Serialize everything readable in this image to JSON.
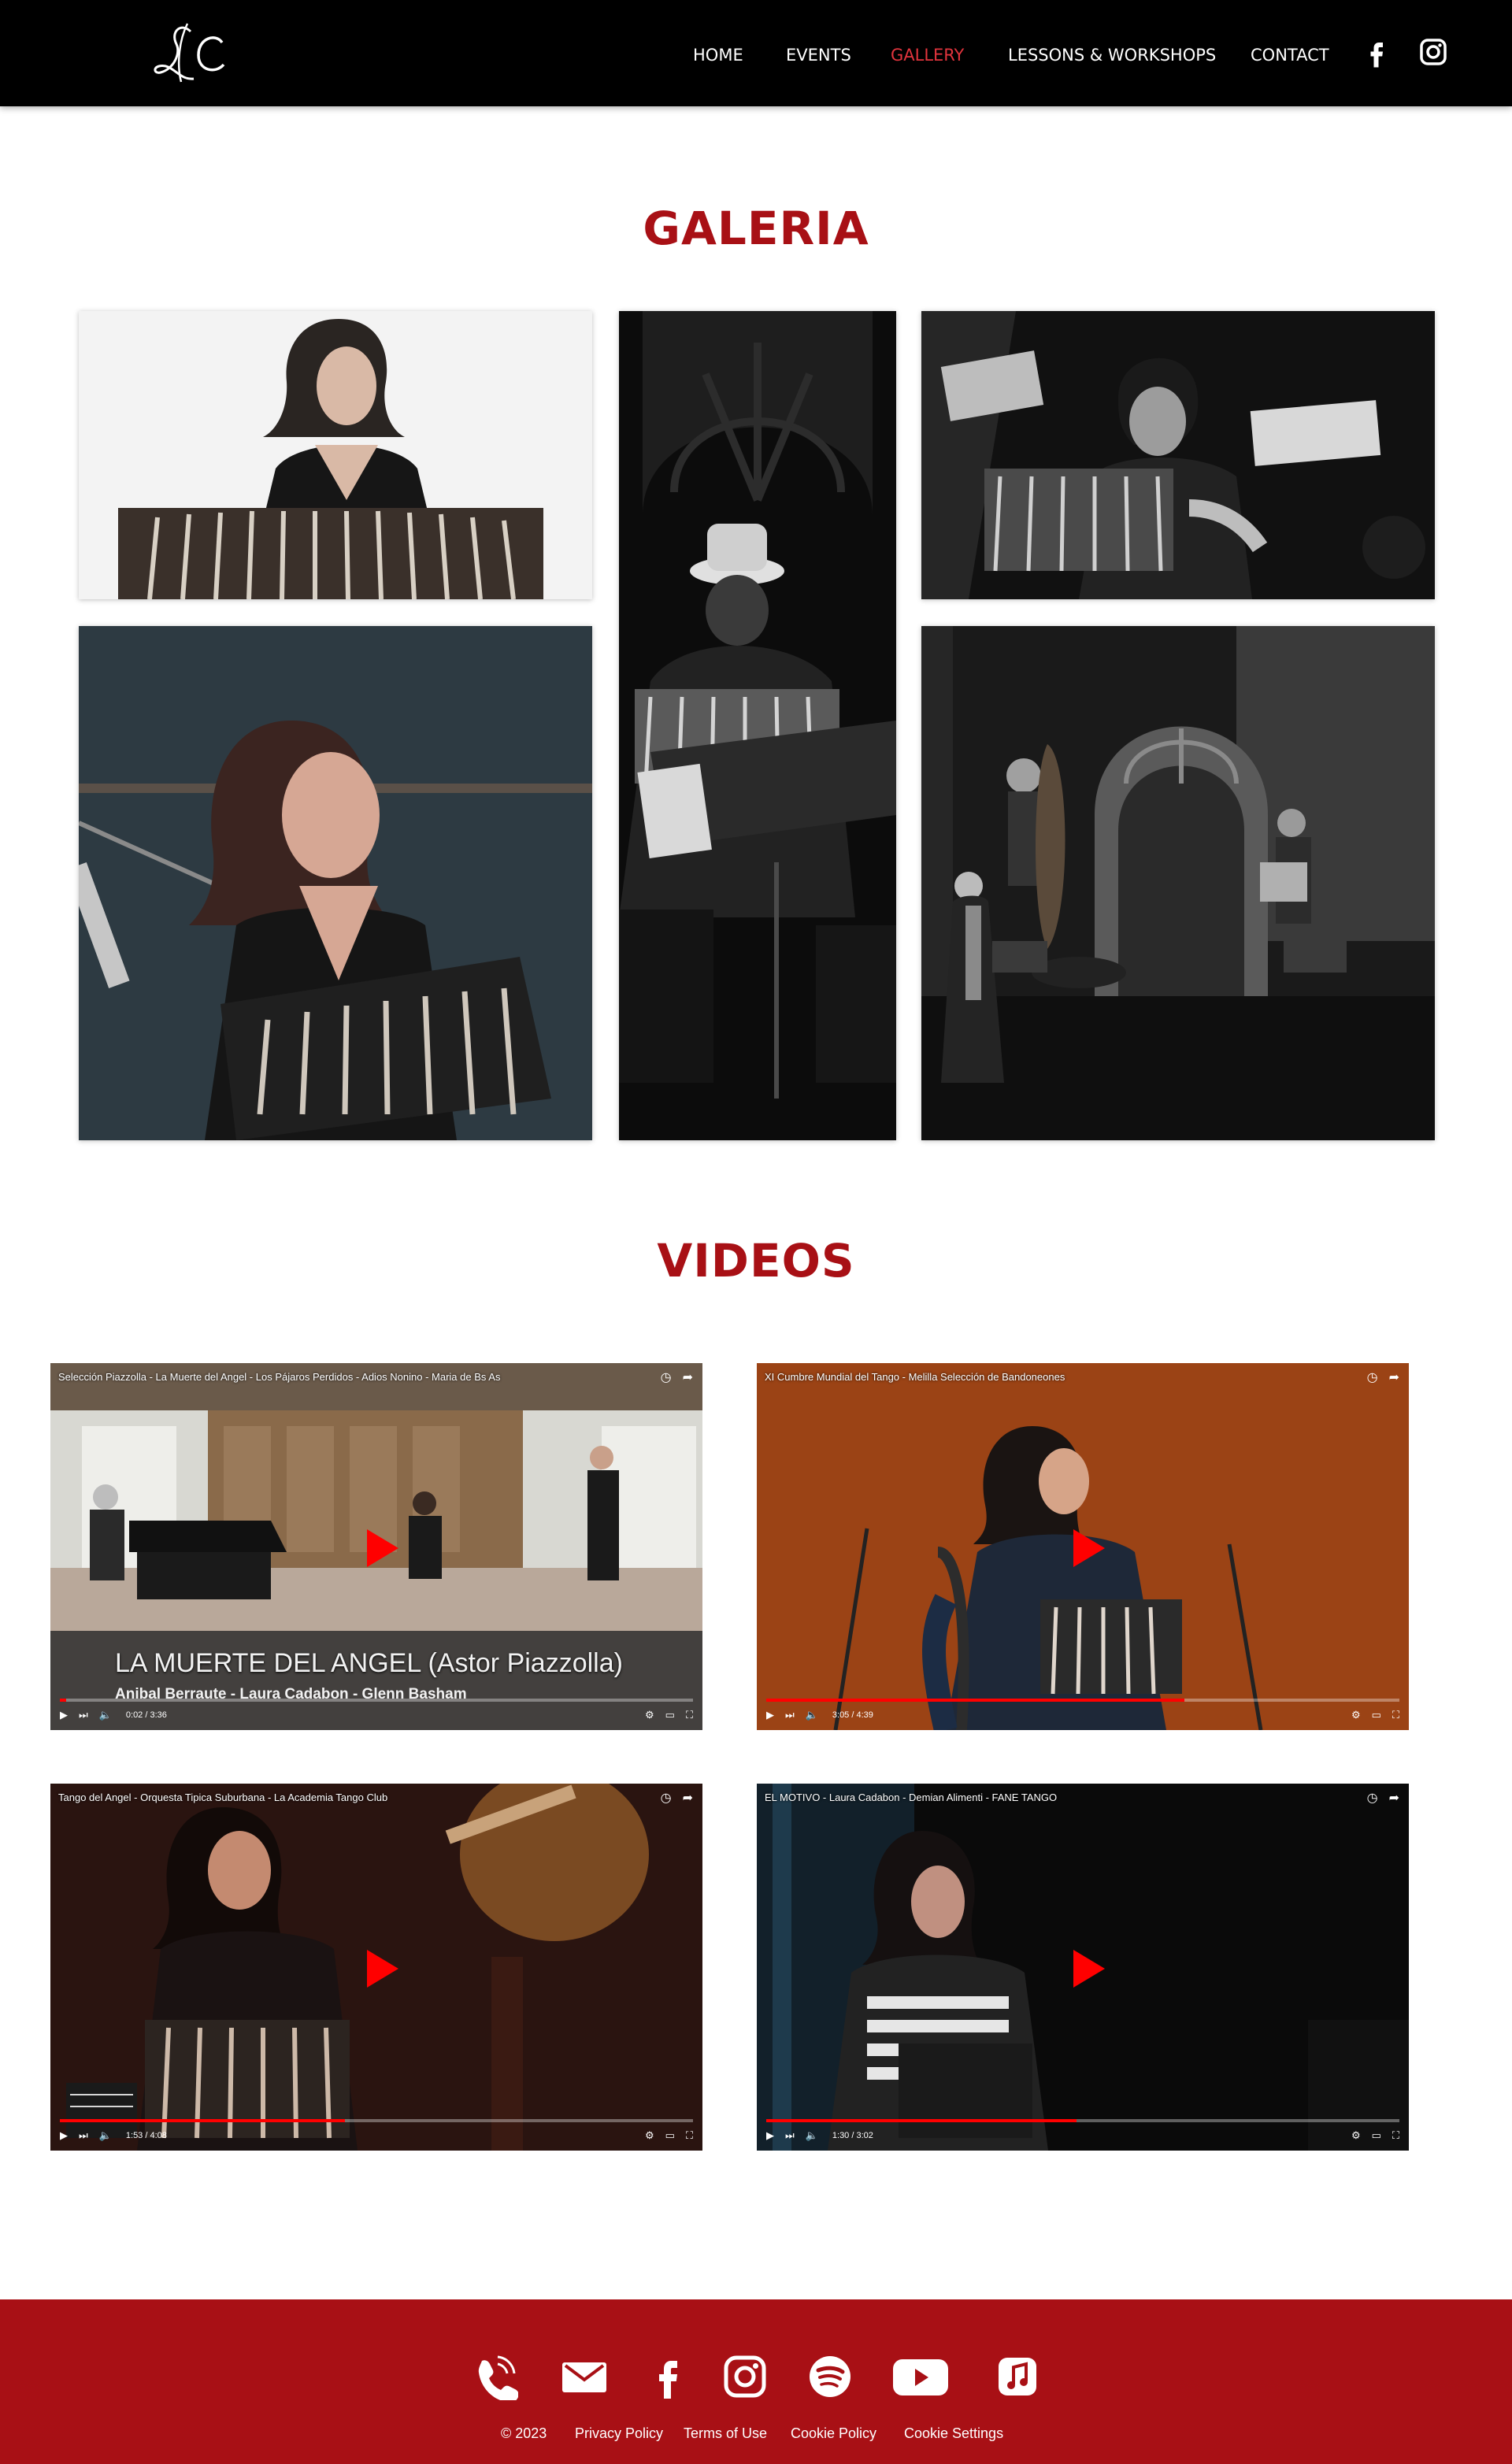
{
  "header": {
    "nav": [
      {
        "label": "HOME",
        "active": false
      },
      {
        "label": "EVENTS",
        "active": false
      },
      {
        "label": "GALLERY",
        "active": true
      },
      {
        "label": "LESSONS & WORKSHOPS",
        "active": false
      },
      {
        "label": "CONTACT",
        "active": false
      }
    ],
    "social_icons": [
      "facebook-icon",
      "instagram-icon"
    ]
  },
  "gallery": {
    "title": "GALERIA"
  },
  "videos": {
    "title": "VIDEOS",
    "items": [
      {
        "title": "Selección Piazzolla - La Muerte del Angel - Los Pájaros Perdidos - Adios Nonino - Maria de Bs As",
        "time": "0:02 / 3:36",
        "progress": 0.01,
        "overlay_title": "LA MUERTE DEL ANGEL (Astor Piazzolla)",
        "overlay_sub": "Anibal Berraute - Laura Cadabon - Glenn Basham"
      },
      {
        "title": "XI Cumbre Mundial del Tango - Melilla Selección de Bandoneones",
        "time": "3:05 / 4:39",
        "progress": 0.66
      },
      {
        "title": "Tango del Angel - Orquesta Tipica Suburbana - La Academia Tango Club",
        "time": "1:53 / 4:08",
        "progress": 0.45
      },
      {
        "title": "EL MOTIVO - Laura Cadabon - Demian Alimenti - FANE TANGO",
        "time": "1:30 / 3:02",
        "progress": 0.49
      }
    ]
  },
  "footer": {
    "icons": [
      "phone-icon",
      "mail-icon",
      "facebook-icon",
      "instagram-icon",
      "spotify-icon",
      "youtube-icon",
      "music-icon"
    ],
    "links": {
      "copyright": "© 2023",
      "privacy": "Privacy Policy",
      "terms": "Terms of Use",
      "cookie_policy": "Cookie Policy",
      "cookie_settings": "Cookie Settings"
    }
  },
  "colors": {
    "accent": "#a81015",
    "nav_active": "#e1343d",
    "header_bg": "#000000"
  }
}
